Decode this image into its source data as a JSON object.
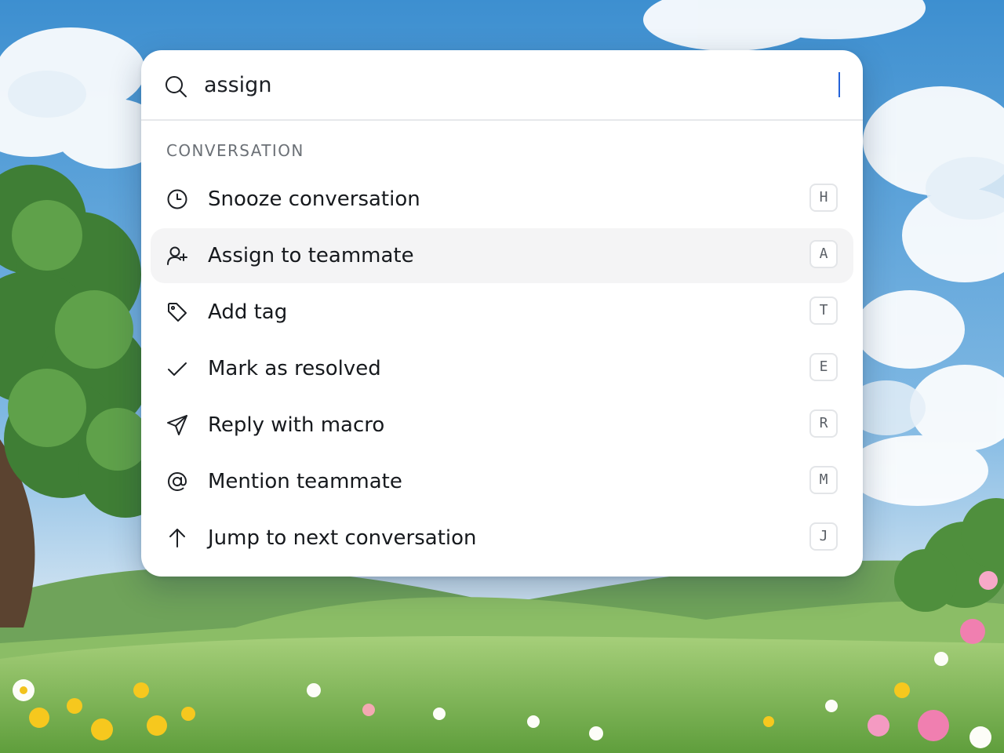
{
  "search": {
    "value": "assign",
    "icon": "search-icon"
  },
  "section": {
    "label": "CONVERSATION"
  },
  "commands": [
    {
      "label": "Snooze conversation",
      "shortcut": "H",
      "icon": "clock-icon",
      "active": false
    },
    {
      "label": "Assign to teammate",
      "shortcut": "A",
      "icon": "user-plus-icon",
      "active": true
    },
    {
      "label": "Add tag",
      "shortcut": "T",
      "icon": "tag-icon",
      "active": false
    },
    {
      "label": "Mark as resolved",
      "shortcut": "E",
      "icon": "check-icon",
      "active": false
    },
    {
      "label": "Reply with macro",
      "shortcut": "R",
      "icon": "send-icon",
      "active": false
    },
    {
      "label": "Mention teammate",
      "shortcut": "M",
      "icon": "at-sign-icon",
      "active": false
    },
    {
      "label": "Jump to next conversation",
      "shortcut": "J",
      "icon": "arrow-up-icon",
      "active": false
    }
  ],
  "colors": {
    "caret": "#2463d8",
    "active_row": "#f4f4f5",
    "sky": "#4a9bd3",
    "meadow": "#8fc45f"
  }
}
